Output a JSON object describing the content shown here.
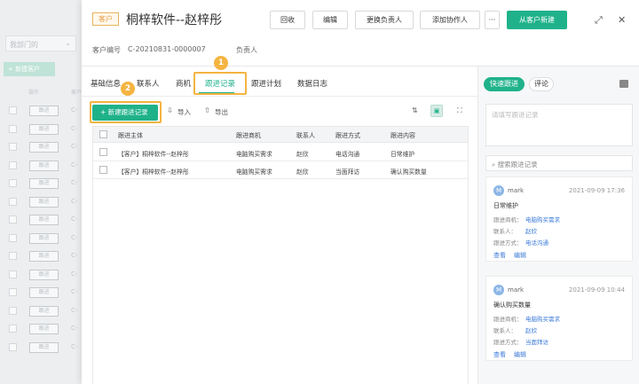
{
  "background": {
    "dept_select": "我部门的",
    "new_button": "+ 新建客户",
    "header": [
      "操作",
      "客户"
    ],
    "row_tag": "跟进",
    "row_prefix": "C-",
    "row_count": 14
  },
  "header": {
    "badge": "客户",
    "title": "桐梓软件--赵梓彤",
    "buttons": [
      "回收",
      "编辑",
      "更换负责人",
      "添加协作人",
      "···"
    ],
    "primary_button": "从客户新建",
    "expand_icon": "expand-icon",
    "close_icon": "close-icon"
  },
  "meta": {
    "id_label": "客户编号",
    "id_value": "C-20210831-0000007",
    "owner_label": "负责人"
  },
  "tabs": [
    "基础信息",
    "联系人",
    "商机",
    "跟进记录",
    "跟进计划",
    "数据日志"
  ],
  "active_tab": "跟进记录",
  "markers": [
    "1",
    "2"
  ],
  "toolbar": {
    "new_record": "+ 新建跟进记录",
    "import": "导入",
    "export": "导出"
  },
  "table": {
    "columns": [
      "跟进主体",
      "跟进商机",
      "联系人",
      "跟进方式",
      "跟进内容"
    ],
    "rows": [
      [
        "【客户】桐梓软件--赵梓彤",
        "电脑购买需求",
        "赵欣",
        "电话沟通",
        "日常维护"
      ],
      [
        "【客户】桐梓软件--赵梓彤",
        "电脑购买需求",
        "赵欣",
        "当面拜访",
        "确认购买数量"
      ]
    ]
  },
  "side": {
    "tab_quick": "快速跟进",
    "tab_comment": "评论",
    "textarea_placeholder": "请填写跟进记录",
    "search_placeholder": "搜索跟进记录",
    "records": [
      {
        "avatar": "M",
        "user": "mark",
        "date": "2021-09-09 17:36",
        "title": "日常维护",
        "opportunity_label": "跟进商机：",
        "opportunity": "电脑购买需求",
        "contact_label": "联系人：",
        "contact": "赵欣",
        "method_label": "跟进方式：",
        "method": "电话沟通",
        "view": "查看",
        "edit": "编辑"
      },
      {
        "avatar": "M",
        "user": "mark",
        "date": "2021-09-09 10:44",
        "title": "确认购买数量",
        "opportunity_label": "跟进商机：",
        "opportunity": "电脑购买需求",
        "contact_label": "联系人：",
        "contact": "赵欣",
        "method_label": "跟进方式：",
        "method": "当面拜访",
        "view": "查看",
        "edit": "编辑"
      }
    ]
  },
  "colors": {
    "primary": "#1fb28a",
    "highlight": "#f5b441",
    "badge": "#e8a24a",
    "link": "#3a7ad8"
  }
}
